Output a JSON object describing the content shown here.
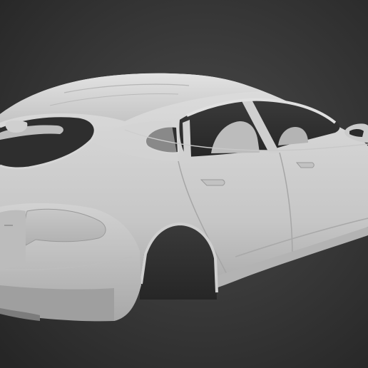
{
  "viewport": {
    "subject": "3d-car-body-model",
    "render_style": "gray-clay-shaded",
    "colors": {
      "background_center": "#4a4a4a",
      "background_edge": "#262626",
      "body_light": "#d9d9d9",
      "body_mid": "#bdbdbd",
      "body_shadow": "#8c8c8c",
      "cavity_dark": "#2c2c2c",
      "line_crease": "#a6a6a6"
    }
  }
}
